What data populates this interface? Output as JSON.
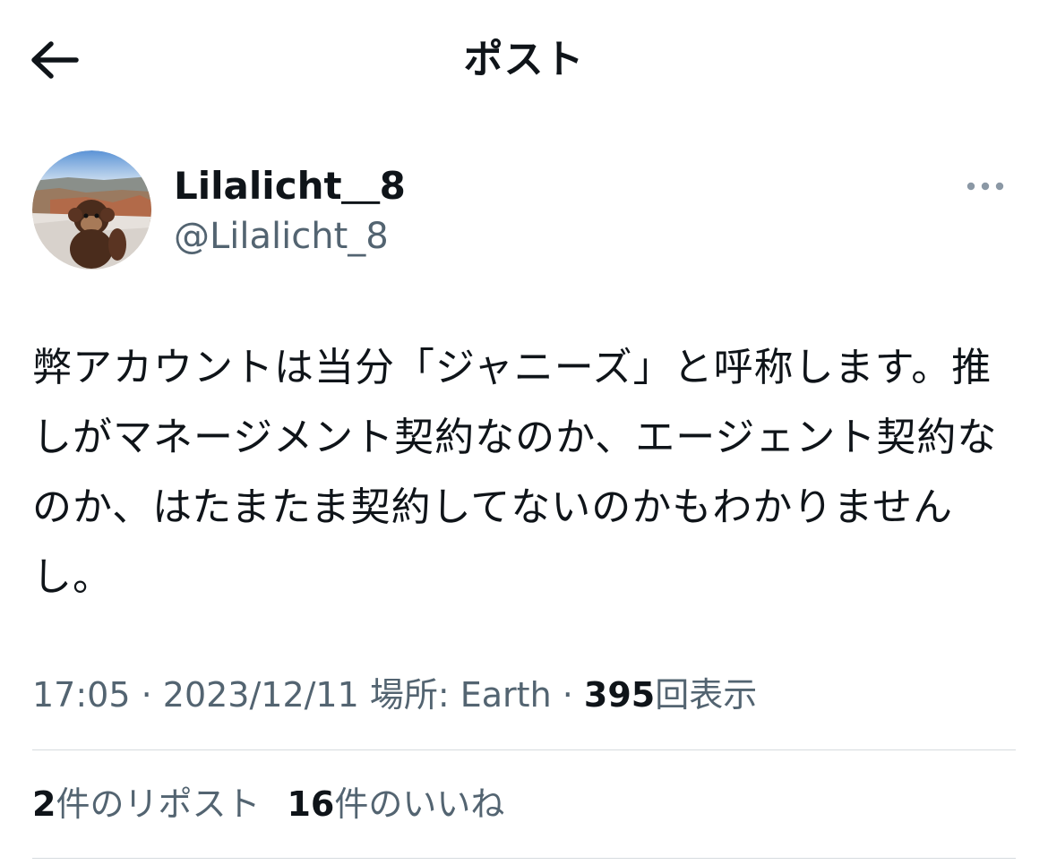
{
  "header": {
    "back_icon": "arrow-left-icon",
    "title": "ポスト"
  },
  "author": {
    "display_name": "Lilalicht＿8",
    "handle": "@Lilalicht_8",
    "avatar_icon": "avatar-photo-monkey-plush-canyon",
    "more_icon": "more-horizontal-icon"
  },
  "post": {
    "text": "弊アカウントは当分「ジャニーズ」と呼称します。推しがマネージメント契約なのか、エージェント契約なのか、はたまたま契約してないのかもわかりませんし。"
  },
  "meta": {
    "time": "17:05",
    "sep1": " · ",
    "date": "2023/12/11",
    "location": " 場所: Earth",
    "sep2": " · ",
    "views_count": "395",
    "views_label": "回表示"
  },
  "stats": {
    "reposts_count": "2",
    "reposts_label": "件のリポスト",
    "likes_count": "16",
    "likes_label": "件のいいね"
  },
  "colors": {
    "text_primary": "#0f1419",
    "text_secondary": "#536471",
    "divider": "#d6dbdf",
    "background": "#ffffff"
  }
}
